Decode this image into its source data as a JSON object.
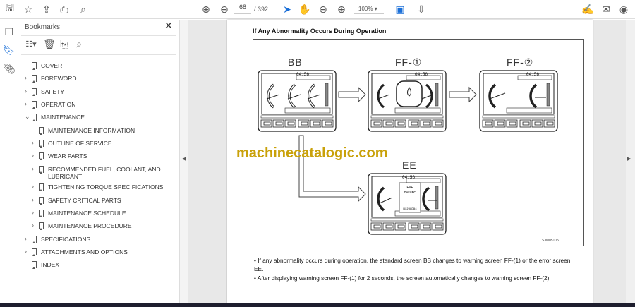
{
  "toolbar": {
    "icons": [
      "save-icon",
      "bookmark-star-icon",
      "cloud-upload-icon",
      "print-icon",
      "zoom-search-icon",
      "page-up-icon",
      "page-down-icon",
      "select-cursor-icon",
      "hand-icon",
      "zoom-out-icon",
      "zoom-in-icon",
      "fit-page-icon",
      "scroll-mode-icon",
      "sign-icon",
      "email-icon",
      "account-icon"
    ],
    "current_page": "68",
    "total_pages": "/ 392",
    "zoom": "100%"
  },
  "bookmarks": {
    "title": "Bookmarks",
    "items": [
      {
        "label": "COVER",
        "level": 0,
        "expandable": false
      },
      {
        "label": "FOREWORD",
        "level": 0,
        "expandable": true
      },
      {
        "label": "SAFETY",
        "level": 0,
        "expandable": true
      },
      {
        "label": "OPERATION",
        "level": 0,
        "expandable": true
      },
      {
        "label": "MAINTENANCE",
        "level": 0,
        "expandable": true,
        "expanded": true
      },
      {
        "label": "MAINTENANCE INFORMATION",
        "level": 1,
        "expandable": false
      },
      {
        "label": "OUTLINE OF SERVICE",
        "level": 1,
        "expandable": true
      },
      {
        "label": "WEAR PARTS",
        "level": 1,
        "expandable": true
      },
      {
        "label": "RECOMMENDED FUEL, COOLANT, AND LUBRICANT",
        "level": 1,
        "expandable": true
      },
      {
        "label": "TIGHTENING TORQUE SPECIFICATIONS",
        "level": 1,
        "expandable": true
      },
      {
        "label": "SAFETY CRITICAL PARTS",
        "level": 1,
        "expandable": true
      },
      {
        "label": "MAINTENANCE SCHEDULE",
        "level": 1,
        "expandable": true
      },
      {
        "label": "MAINTENANCE PROCEDURE",
        "level": 1,
        "expandable": true
      },
      {
        "label": "SPECIFICATIONS",
        "level": 0,
        "expandable": true
      },
      {
        "label": "ATTACHMENTS AND OPTIONS",
        "level": 0,
        "expandable": true
      },
      {
        "label": "INDEX",
        "level": 0,
        "expandable": false
      }
    ]
  },
  "document": {
    "heading": "If Any Abnormality Occurs During Operation",
    "screens": {
      "bb": "BB",
      "ff1": "FF-①",
      "ff2": "FF-②",
      "ee": "EE"
    },
    "monitor_clock": "04:56",
    "ee_codes": [
      "E0E",
      "DAF8MC",
      "N1298D84"
    ],
    "figure_code": "SJM05105",
    "watermark": "machinecatalogic.com",
    "bullets": [
      "If any abnormality occurs during operation, the standard screen BB changes to warning screen FF-(1) or the error screen EE.",
      "After displaying warning screen FF-(1) for 2 seconds, the screen automatically changes to warning screen FF-(2)."
    ]
  }
}
